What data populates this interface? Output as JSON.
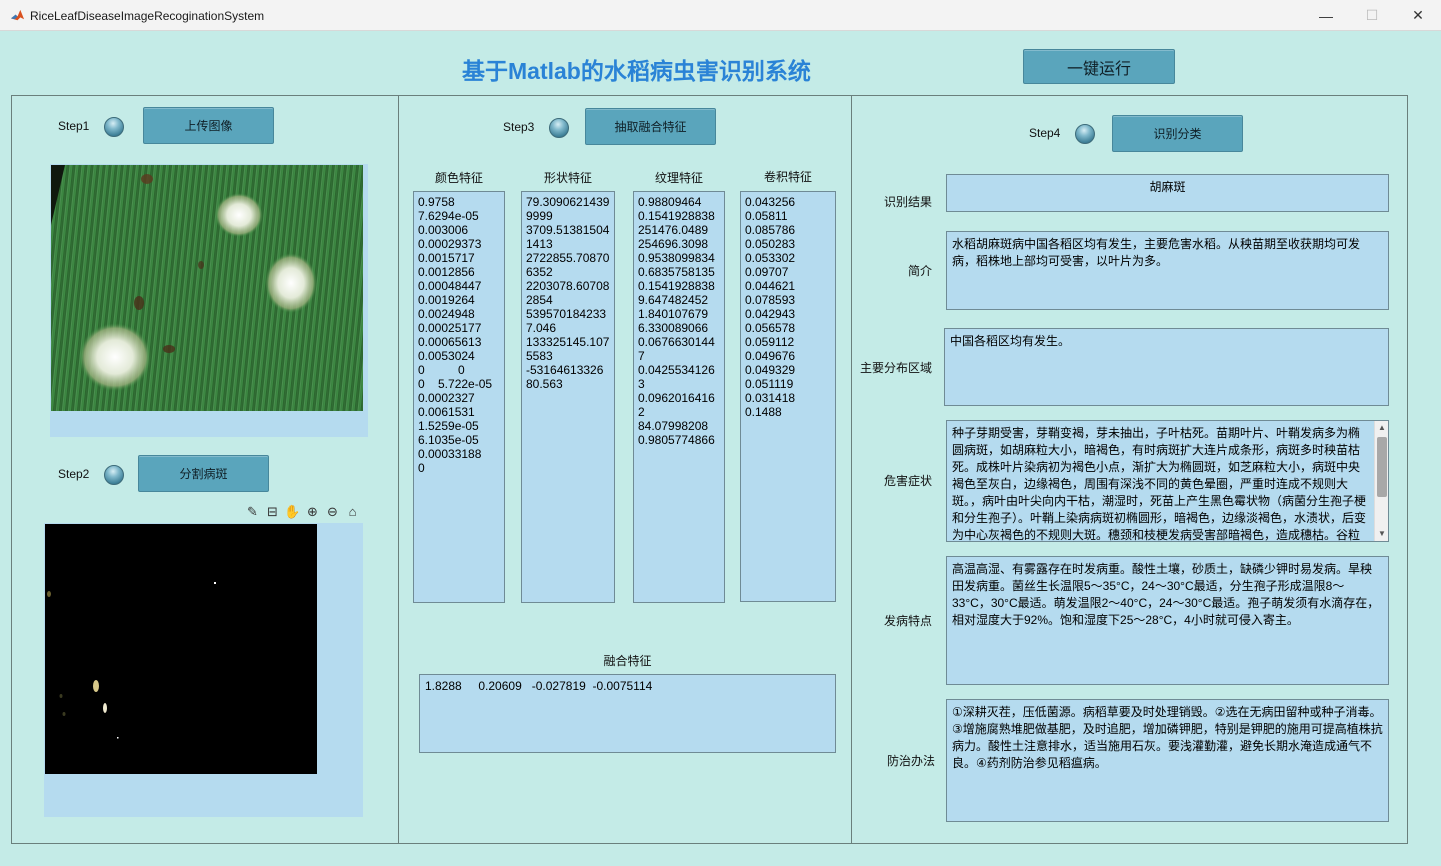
{
  "window": {
    "title": "RiceLeafDiseaseImageRecoginationSystem",
    "minimize_glyph": "—",
    "maximize_glyph": "☐",
    "close_glyph": "✕"
  },
  "header": {
    "title": "基于Matlab的水稻病虫害识别系统",
    "run_button": "一键运行"
  },
  "step1": {
    "label": "Step1",
    "button": "上传图像"
  },
  "step2": {
    "label": "Step2",
    "button": "分割病斑"
  },
  "step3": {
    "label": "Step3",
    "button": "抽取融合特征"
  },
  "step4": {
    "label": "Step4",
    "button": "识别分类"
  },
  "axes_toolbar": {
    "icons": [
      "brush-icon",
      "data-tip-icon",
      "pan-icon",
      "zoom-in-icon",
      "zoom-out-icon",
      "home-icon"
    ],
    "glyphs": [
      "✎",
      "⊟",
      "✋",
      "⊕",
      "⊖",
      "⌂"
    ]
  },
  "features": {
    "color": {
      "label": "颜色特征",
      "text": "0.9758\n7.6294e-05\n0.003006\n0.00029373\n0.0015717\n0.0012856\n0.00048447\n0.0019264\n0.0024948\n0.00025177\n0.00065613\n0.0053024\n0          0\n0    5.722e-05\n0.0002327\n0.0061531\n1.5259e-05\n6.1035e-05\n0.00033188\n0"
    },
    "shape": {
      "label": "形状特征",
      "text": "79.3090621439\n9999\n3709.51381504\n1413\n2722855.70870\n6352\n2203078.60708\n2854\n539570184233\n7.046\n133325145.107\n5583\n-53164613326\n80.563"
    },
    "texture": {
      "label": "纹理特征",
      "text": "0.98809464\n0.1541928838\n251476.0489\n254696.3098\n0.9538099834\n0.6835758135\n0.1541928838\n9.647482452\n1.840107679\n6.330089066\n0.0676630144\n7\n0.0425534126\n3\n0.0962016416\n2\n84.07998208\n0.9805774866"
    },
    "conv": {
      "label": "卷积特征",
      "text": "0.043256\n0.05811\n0.085786\n0.050283\n0.053302\n0.09707\n0.044621\n0.078593\n0.042943\n0.056578\n0.059112\n0.049676\n0.049329\n0.051119\n0.031418\n0.1488"
    },
    "fused": {
      "label": "融合特征",
      "text": "1.8288     0.20609   -0.027819  -0.0075114"
    }
  },
  "result": {
    "label": "识别结果",
    "value": "胡麻斑"
  },
  "intro": {
    "label": "简介",
    "value": "水稻胡麻斑病中国各稻区均有发生，主要危害水稻。从秧苗期至收获期均可发病，稻株地上部均可受害，以叶片为多。"
  },
  "distribution": {
    "label": "主要分布区域",
    "value": "中国各稻区均有发生。"
  },
  "symptoms": {
    "label": "危害症状",
    "value": "种子芽期受害，芽鞘变褐，芽未抽出，子叶枯死。苗期叶片、叶鞘发病多为椭圆病斑，如胡麻粒大小，暗褐色，有时病斑扩大连片成条形，病斑多时秧苗枯死。成株叶片染病初为褐色小点，渐扩大为椭圆斑，如芝麻粒大小，病斑中央褐色至灰白，边缘褐色，周围有深浅不同的黄色晕圈，严重时连成不规则大斑。，病叶由叶尖向内干枯，潮湿时，死苗上产生黑色霉状物（病菌分生孢子梗和分生孢子）。叶鞘上染病病斑初椭圆形，暗褐色，边缘淡褐色，水渍状，后变为中心灰褐色的不规则大斑。穗颈和枝梗发病受害部暗褐色，造成穗枯。谷粒"
  },
  "conditions": {
    "label": "发病特点",
    "value": "高温高湿、有雾露存在时发病重。酸性土壤，砂质土，缺磷少钾时易发病。旱秧田发病重。菌丝生长温限5～35°C，24～30°C最适，分生孢子形成温限8～33°C，30°C最适。萌发温限2～40°C，24～30°C最适。孢子萌发须有水滴存在，相对湿度大于92%。饱和湿度下25～28°C，4小时就可侵入寄主。"
  },
  "prevention": {
    "label": "防治办法",
    "value": "①深耕灭茬，压低菌源。病稻草要及时处理销毁。②选在无病田留种或种子消毒。③增施腐熟堆肥做基肥，及时追肥，增加磷钾肥，特别是钾肥的施用可提高植株抗病力。酸性土注意排水，适当施用石灰。要浅灌勤灌，避免长期水淹造成通气不良。④药剂防治参见稻瘟病。"
  }
}
